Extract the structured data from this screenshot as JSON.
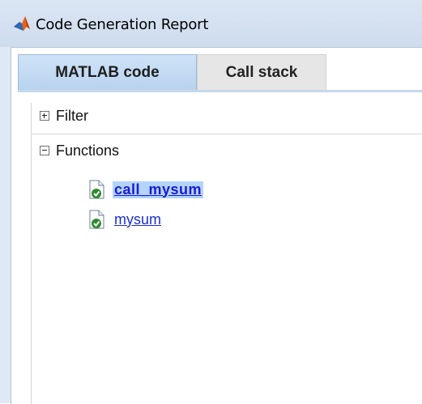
{
  "window": {
    "title": "Code Generation Report"
  },
  "tabs": [
    {
      "label": "MATLAB code",
      "active": true
    },
    {
      "label": "Call stack",
      "active": false
    }
  ],
  "tree": {
    "filter_label": "Filter",
    "functions_label": "Functions",
    "functions": [
      {
        "name": "call_mysum",
        "selected": true,
        "status": "ok"
      },
      {
        "name": "mysum",
        "selected": false,
        "status": "ok"
      }
    ]
  },
  "colors": {
    "accent_tab": "#b8d3ee",
    "link": "#1a2fd2",
    "selection": "#b3d4fc",
    "status_ok": "#2e8b2e"
  },
  "icons": {
    "app": "matlab-logo-icon",
    "expand": "plus-box-icon",
    "collapse": "minus-box-icon",
    "file": "document-check-icon"
  }
}
